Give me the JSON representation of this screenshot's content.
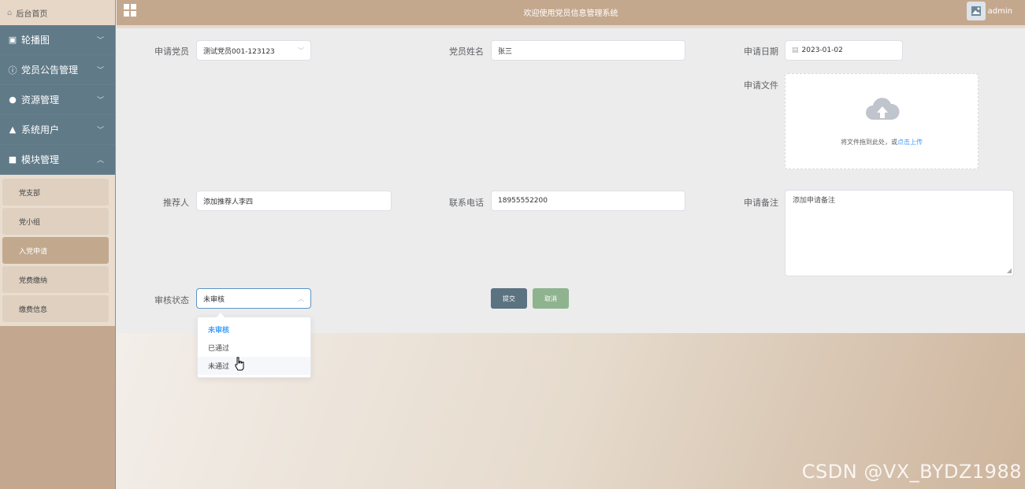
{
  "sidebar": {
    "home": "后台首页",
    "items": [
      {
        "label": "轮播图",
        "icon": "picture-icon",
        "arrow": "﹀"
      },
      {
        "label": "党员公告管理",
        "icon": "info-icon",
        "arrow": "﹀"
      },
      {
        "label": "资源管理",
        "icon": "bulb-icon",
        "arrow": "﹀"
      },
      {
        "label": "系统用户",
        "icon": "user-icon",
        "arrow": "﹀"
      },
      {
        "label": "模块管理",
        "icon": "menu-icon",
        "arrow": "︿"
      }
    ],
    "subitems": [
      {
        "label": "党支部",
        "active": false
      },
      {
        "label": "党小组",
        "active": false
      },
      {
        "label": "入党申请",
        "active": true
      },
      {
        "label": "党费缴纳",
        "active": false
      },
      {
        "label": "缴费信息",
        "active": false
      }
    ]
  },
  "header": {
    "title": "欢迎使用党员信息管理系统",
    "user": "admin"
  },
  "form": {
    "applicant_label": "申请党员",
    "applicant_value": "测试党员001-123123",
    "name_label": "党员姓名",
    "name_value": "张三",
    "date_label": "申请日期",
    "date_value": "2023-01-02",
    "file_label": "申请文件",
    "upload_text": "将文件拖到此处，或",
    "upload_link": "点击上传",
    "recommender_label": "推荐人",
    "recommender_value": "添加推荐人李四",
    "phone_label": "联系电话",
    "phone_value": "18955552200",
    "remark_label": "申请备注",
    "remark_value": "添加申请备注",
    "status_label": "审核状态",
    "status_value": "未审核",
    "status_options": [
      "未审核",
      "已通过",
      "未通过"
    ],
    "submit": "提交",
    "cancel": "取消"
  },
  "watermark": "CSDN @VX_BYDZ1988"
}
